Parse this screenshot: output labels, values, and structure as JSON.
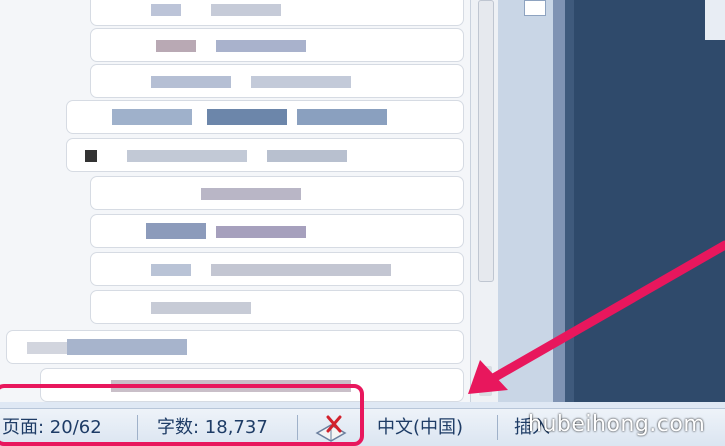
{
  "status_bar": {
    "page_label": "页面: 20/62",
    "word_count_label": "字数: 18,737",
    "language_label": "中文(中国)",
    "insert_label": "插入"
  },
  "icons": {
    "proofing": "spell-check-book-icon"
  },
  "watermark": "hubeihong.com",
  "colors": {
    "highlight": "#e8175d",
    "arrow": "#e8175d",
    "status_text": "#1e3c66"
  }
}
